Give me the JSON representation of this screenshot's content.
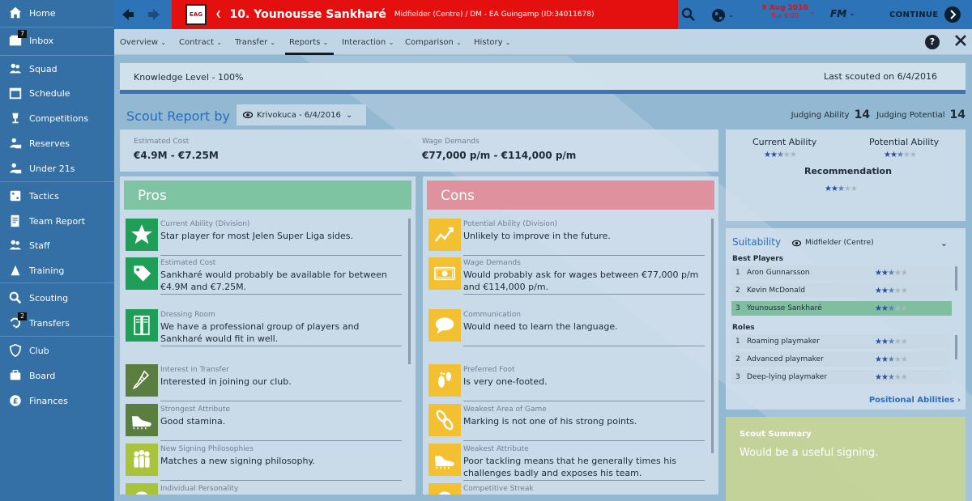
{
  "sidebar": {
    "items": [
      {
        "label": "Home",
        "icon": "home-icon"
      },
      {
        "label": "Inbox",
        "icon": "inbox-icon",
        "badge": "7"
      },
      {
        "label": "Squad",
        "icon": "squad-icon"
      },
      {
        "label": "Schedule",
        "icon": "schedule-icon"
      },
      {
        "label": "Competitions",
        "icon": "trophy-icon"
      },
      {
        "label": "Reserves",
        "icon": "reserves-icon"
      },
      {
        "label": "Under 21s",
        "icon": "under21-icon"
      },
      {
        "label": "Tactics",
        "icon": "tactics-icon"
      },
      {
        "label": "Team Report",
        "icon": "team-report-icon"
      },
      {
        "label": "Staff",
        "icon": "staff-icon"
      },
      {
        "label": "Training",
        "icon": "training-icon"
      },
      {
        "label": "Scouting",
        "icon": "scouting-icon"
      },
      {
        "label": "Transfers",
        "icon": "transfers-icon",
        "badge": "2"
      },
      {
        "label": "Club",
        "icon": "club-icon"
      },
      {
        "label": "Board",
        "icon": "board-icon"
      },
      {
        "label": "Finances",
        "icon": "finances-icon"
      }
    ]
  },
  "header": {
    "club_badge": "EAG",
    "player_title": "10. Younousse Sankharé",
    "player_subtitle": "Midfielder (Centre) / DM - EA Guingamp (ID:34011678)",
    "date": "9 Aug 2016",
    "time": "Tue 6:00",
    "fm_label": "FM",
    "continue_label": "CONTINUE"
  },
  "tabs": [
    "Overview",
    "Contract",
    "Transfer",
    "Reports",
    "Interaction",
    "Comparison",
    "History"
  ],
  "active_tab": "Reports",
  "knowledge": {
    "level": "Knowledge Level - 100%",
    "last_scouted": "Last scouted on 6/4/2016"
  },
  "scout": {
    "title": "Scout Report by",
    "scout_name": "Krivokuca - 6/4/2016",
    "judging_ability_label": "Judging Ability",
    "judging_ability": "14",
    "judging_potential_label": "Judging Potential",
    "judging_potential": "14"
  },
  "costs": {
    "estimated_label": "Estimated Cost",
    "estimated_value": "€4.9M - €7.25M",
    "wage_label": "Wage Demands",
    "wage_value": "€77,000 p/m - €114,000 p/m"
  },
  "ratings": {
    "current_label": "Current Ability",
    "current_stars": 2.5,
    "potential_label": "Potential Ability",
    "potential_stars": 2.5,
    "recommendation_label": "Recommendation",
    "recommendation_stars": 2.5
  },
  "pros": {
    "title": "Pros",
    "items": [
      {
        "category": "Current Ability (Division)",
        "text": "Star player for most Jelen Super Liga sides.",
        "icon": "star-icon",
        "color": "#1f9e57"
      },
      {
        "category": "Estimated Cost",
        "text": "Sankharé would probably be available for between €4.9M and €7.25M.",
        "icon": "price-tag-icon",
        "color": "#1f9e57"
      },
      {
        "category": "Dressing Room",
        "text": "We have a professional group of players and Sankharé would fit in well.",
        "icon": "dressing-room-icon",
        "color": "#1f9e57"
      },
      {
        "category": "Interest in Transfer",
        "text": "Interested in joining our club.",
        "icon": "thermometer-icon",
        "color": "#5a7d40"
      },
      {
        "category": "Strongest Attribute",
        "text": "Good stamina.",
        "icon": "boot-icon",
        "color": "#5a7d40"
      },
      {
        "category": "New Signing Philosophies",
        "text": "Matches a new signing philosophy.",
        "icon": "people-icon",
        "color": "#a9c43c"
      },
      {
        "category": "Individual Personality",
        "text": "",
        "icon": "personality-icon",
        "color": "#a9c43c"
      }
    ]
  },
  "cons": {
    "title": "Cons",
    "items": [
      {
        "category": "Potential Ability (Division)",
        "text": "Unlikely to improve in the future.",
        "icon": "trend-icon",
        "color": "#f2c031"
      },
      {
        "category": "Wage Demands",
        "text": "Would probably ask for wages between €77,000 p/m and €114,000 p/m.",
        "icon": "money-icon",
        "color": "#f2c031"
      },
      {
        "category": "Communication",
        "text": "Would need to learn the language.",
        "icon": "speech-icon",
        "color": "#f2c031"
      },
      {
        "category": "Preferred Foot",
        "text": "Is very one-footed.",
        "icon": "footprint-icon",
        "color": "#f2c031"
      },
      {
        "category": "Weakest Area of Game",
        "text": "Marking is not one of his strong points.",
        "icon": "chain-icon",
        "color": "#f2c031"
      },
      {
        "category": "Weakest Attribute",
        "text": "Poor tackling means that he generally times his challenges badly and exposes his team.",
        "icon": "boot-icon",
        "color": "#f2c031"
      },
      {
        "category": "Competitive Streak",
        "text": "",
        "icon": "competitive-icon",
        "color": "#f2c031"
      }
    ]
  },
  "suitability": {
    "title": "Suitability",
    "position": "Midfielder (Centre)",
    "best_players_label": "Best Players",
    "best_players": [
      {
        "num": "1",
        "name": "Aron Gunnarsson",
        "stars": 2.5
      },
      {
        "num": "2",
        "name": "Kevin McDonald",
        "stars": 2.5
      },
      {
        "num": "3",
        "name": "Younousse Sankharé",
        "stars": 2.5
      }
    ],
    "roles_label": "Roles",
    "roles": [
      {
        "num": "1",
        "name": "Roaming playmaker",
        "stars": 2.5
      },
      {
        "num": "2",
        "name": "Advanced playmaker",
        "stars": 2.5
      },
      {
        "num": "3",
        "name": "Deep-lying playmaker",
        "stars": 2.5
      }
    ],
    "link": "Positional Abilities"
  },
  "summary": {
    "title": "Scout Summary",
    "text": "Would be a useful signing."
  },
  "colors": {
    "sidebar": "#346fa6",
    "topbar": "#2d73b8",
    "title_red": "#e41010",
    "pros": "#7ec4a2",
    "cons": "#e0919e",
    "star": "#2b4f9e",
    "highlight": "#7fbf9f"
  }
}
